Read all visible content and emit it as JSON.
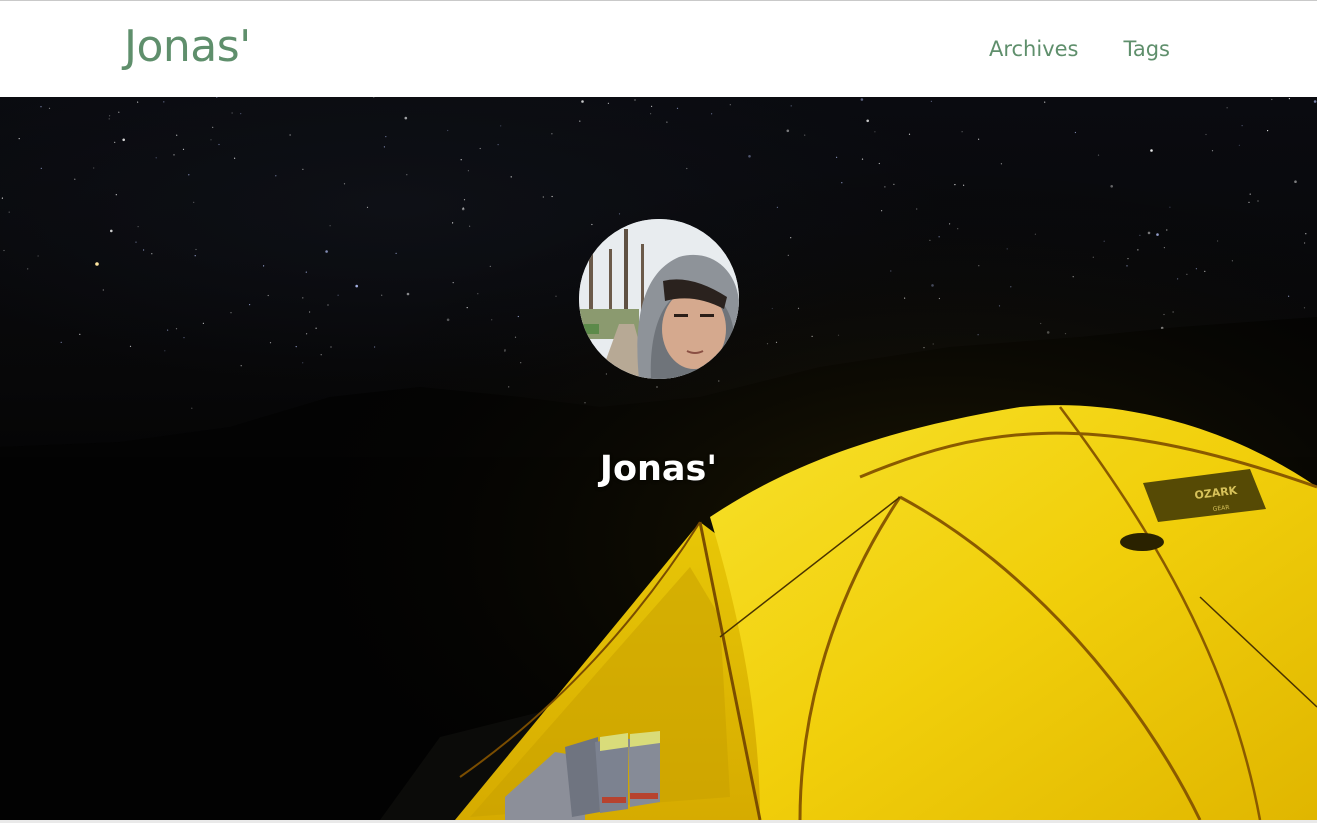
{
  "site": {
    "brand": "Jonas'",
    "nav": [
      {
        "label": "Archives"
      },
      {
        "label": "Tags"
      }
    ]
  },
  "hero": {
    "title": "Jonas'",
    "tent_brand": "OZARK",
    "tent_sub": "GEAR"
  },
  "colors": {
    "accent": "#5f8f6c",
    "tent": "#f3d20c",
    "tent_dark": "#c79a00",
    "sky": "#07080c"
  }
}
